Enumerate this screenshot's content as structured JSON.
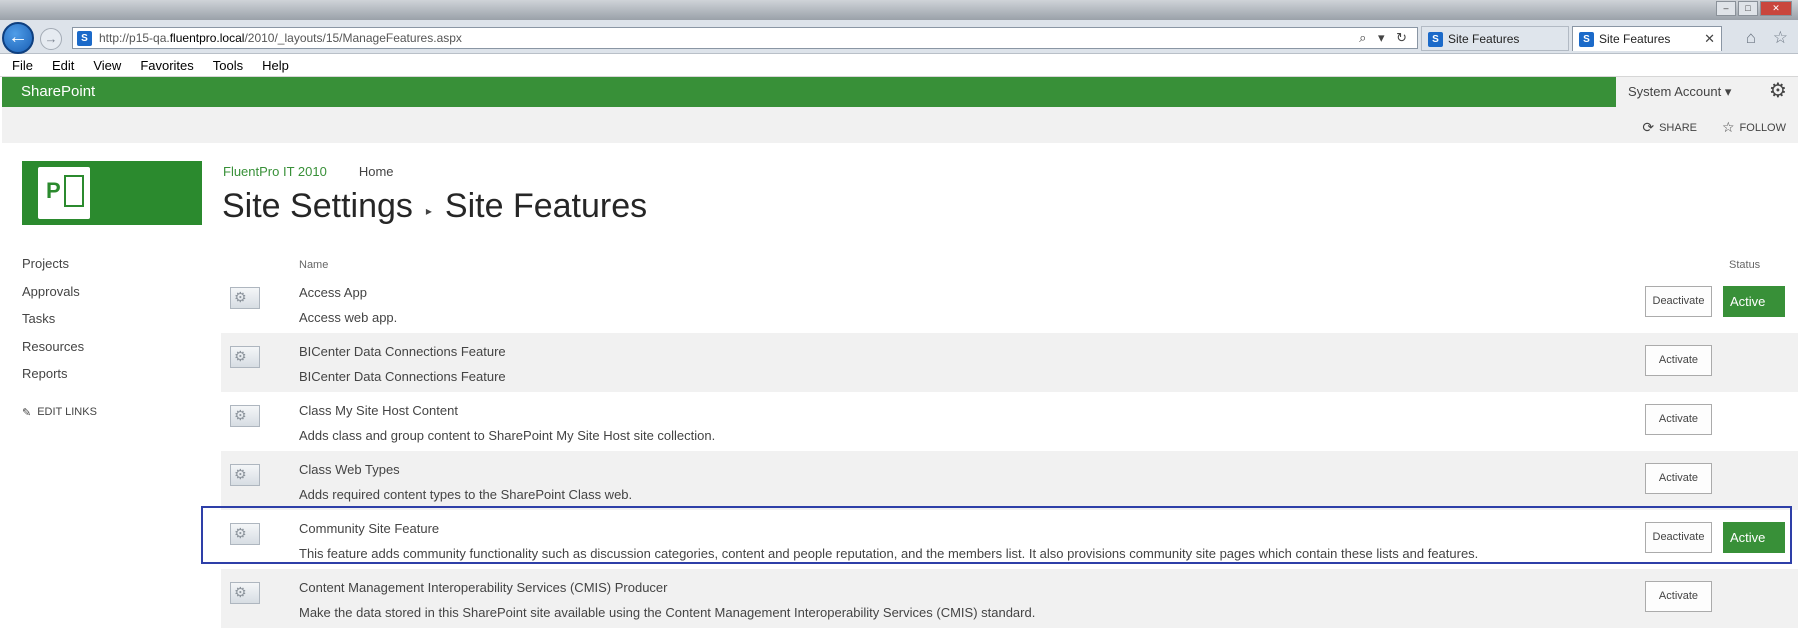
{
  "browser": {
    "url_prefix": "http://p15-qa.",
    "url_domain": "fluentpro.local",
    "url_suffix": "/2010/_layouts/15/ManageFeatures.aspx",
    "url_icons": "⌕ ▾ ↻",
    "favicon": "S",
    "tabs": [
      {
        "label": "Site Features"
      },
      {
        "label": "Site Features",
        "close": "✕"
      }
    ],
    "window_controls": {
      "minimize": "–",
      "maximize": "□",
      "close": "✕"
    },
    "home_star": "⌂ ☆"
  },
  "menu": [
    "File",
    "Edit",
    "View",
    "Favorites",
    "Tools",
    "Help"
  ],
  "suitebar": {
    "brand": "SharePoint",
    "account": "System Account ▾",
    "gear": "⚙"
  },
  "actions": {
    "share": "SHARE",
    "follow": "FOLLOW",
    "share_icon": "⟳",
    "follow_icon": "☆"
  },
  "logo": {
    "letter": "P"
  },
  "breadcrumb": {
    "site": "FluentPro IT 2010",
    "home": "Home"
  },
  "title": {
    "part1": "Site Settings",
    "separator": "▸",
    "part2": "Site Features"
  },
  "leftnav": {
    "items": [
      "Projects",
      "Approvals",
      "Tasks",
      "Resources",
      "Reports"
    ],
    "edit_links": "EDIT LINKS",
    "edit_icon": "✎"
  },
  "table": {
    "header_name": "Name",
    "header_status": "Status",
    "rows": [
      {
        "name": "Access App",
        "description": "Access web app.",
        "button": "Deactivate",
        "status": "Active"
      },
      {
        "name": "BICenter Data Connections Feature",
        "description": "BICenter Data Connections Feature",
        "button": "Activate",
        "status": ""
      },
      {
        "name": "Class My Site Host Content",
        "description": "Adds class and group content to SharePoint My Site Host site collection.",
        "button": "Activate",
        "status": ""
      },
      {
        "name": "Class Web Types",
        "description": "Adds required content types to the SharePoint Class web.",
        "button": "Activate",
        "status": ""
      },
      {
        "name": "Community Site Feature",
        "description": "This feature adds community functionality such as discussion categories, content and people reputation, and the members list. It also provisions community site pages which contain these lists and features.",
        "button": "Deactivate",
        "status": "Active"
      },
      {
        "name": "Content Management Interoperability Services (CMIS) Producer",
        "description": "Make the data stored in this SharePoint site available using the Content Management Interoperability Services (CMIS) standard.",
        "button": "Activate",
        "status": ""
      }
    ]
  },
  "colors": {
    "brand_green": "#389038",
    "highlight_border": "#2e3fa8"
  }
}
